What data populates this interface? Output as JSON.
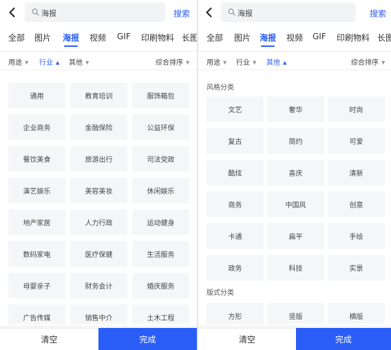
{
  "accent_color": "#2a5df6",
  "left": {
    "search_query": "海报",
    "search_button": "搜索",
    "tabs": [
      "全部",
      "图片",
      "海报",
      "视频",
      "GIF",
      "印刷物料",
      "长图"
    ],
    "active_tab": "海报",
    "filters": {
      "usage": "用途",
      "industry": "行业",
      "other": "其他",
      "sort": "综合排序"
    },
    "active_filter": "行业",
    "industry_options": [
      "通用",
      "教育培训",
      "服饰箱包",
      "企业商务",
      "金融保险",
      "公益环保",
      "餐饮美食",
      "旅游出行",
      "司法党政",
      "演艺娱乐",
      "美容美妆",
      "休闲娱乐",
      "地产家居",
      "人力行政",
      "运动健身",
      "数码家电",
      "医疗保健",
      "生活服务",
      "母婴亲子",
      "财务会计",
      "婚庆服务",
      "广告传媒",
      "销售中介",
      "土木工程"
    ],
    "clear_button": "清空",
    "done_button": "完成"
  },
  "right": {
    "search_query": "海报",
    "search_button": "搜索",
    "tabs": [
      "全部",
      "图片",
      "海报",
      "视频",
      "GIF",
      "印刷物料",
      "长图"
    ],
    "active_tab": "海报",
    "filters": {
      "usage": "用途",
      "industry": "行业",
      "other": "其他",
      "sort": "综合排序"
    },
    "active_filter": "其他",
    "style_section_title": "风格分类",
    "style_options": [
      "文艺",
      "奢华",
      "时尚",
      "复古",
      "简约",
      "可爱",
      "酷炫",
      "喜庆",
      "清新",
      "商务",
      "中国风",
      "创意",
      "卡通",
      "扁平",
      "手绘",
      "政务",
      "科技",
      "实景"
    ],
    "format_section_title": "版式分类",
    "format_options": [
      "方形",
      "竖版",
      "横版"
    ],
    "clear_button": "清空",
    "done_button": "完成"
  }
}
